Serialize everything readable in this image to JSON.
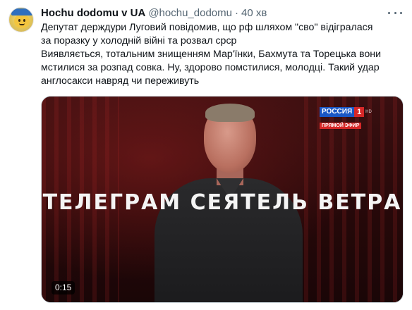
{
  "author": {
    "name": "Hochu dodomu v UA",
    "handle": "@hochu_dodomu",
    "separator": "·",
    "time": "40 хв"
  },
  "tweet": {
    "text": "Депутат держдури Луговий повідомив, що  рф шляхом \"сво\" відігралася\nза поразку у холодній війні та розвал срср\nВиявляється, тотальним знищенням Мар'їнки, Бахмута та Торецька вони\nмстилися за розпад совка. Ну, здорово помстилися, молодці. Такий удар\nанглосакси навряд чи переживуть"
  },
  "media": {
    "overlay_text": "ТЕЛЕГРАМ СЕЯТЕЛЬ ВЕТРА",
    "duration": "0:15",
    "channel_logo": {
      "word": "РОССИЯ",
      "number": "1",
      "hd": "HD",
      "live": "ПРЯМОЙ ЭФИР"
    }
  },
  "icons": {
    "more": "more-icon",
    "avatar": "avatar"
  },
  "colors": {
    "text": "#0f1419",
    "secondary": "#536471",
    "border": "#cfd9de",
    "logo_blue": "#1a57c4",
    "logo_red": "#d62828"
  }
}
